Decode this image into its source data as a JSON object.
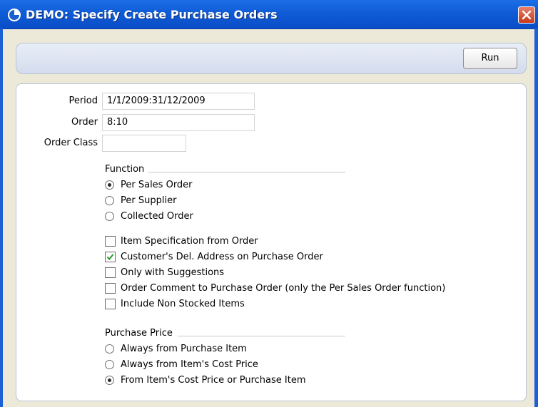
{
  "window": {
    "title": "DEMO: Specify Create Purchase Orders"
  },
  "toolbar": {
    "run_label": "Run"
  },
  "form": {
    "period_label": "Period",
    "period_value": "1/1/2009:31/12/2009",
    "order_label": "Order",
    "order_value": "8:10",
    "order_class_label": "Order Class",
    "order_class_value": ""
  },
  "function_group": {
    "title": "Function",
    "options": [
      {
        "label": "Per Sales Order",
        "selected": true
      },
      {
        "label": "Per Supplier",
        "selected": false
      },
      {
        "label": "Collected Order",
        "selected": false
      }
    ]
  },
  "checkboxes": [
    {
      "label": "Item Specification from Order",
      "checked": false
    },
    {
      "label": "Customer's Del. Address on Purchase Order",
      "checked": true
    },
    {
      "label": "Only with Suggestions",
      "checked": false
    },
    {
      "label": "Order Comment to Purchase Order (only the Per Sales Order function)",
      "checked": false
    },
    {
      "label": "Include Non Stocked Items",
      "checked": false
    }
  ],
  "purchase_price_group": {
    "title": "Purchase Price",
    "options": [
      {
        "label": "Always from Purchase Item",
        "selected": false
      },
      {
        "label": "Always from Item's Cost Price",
        "selected": false
      },
      {
        "label": "From Item's Cost Price or Purchase Item",
        "selected": true
      }
    ]
  }
}
